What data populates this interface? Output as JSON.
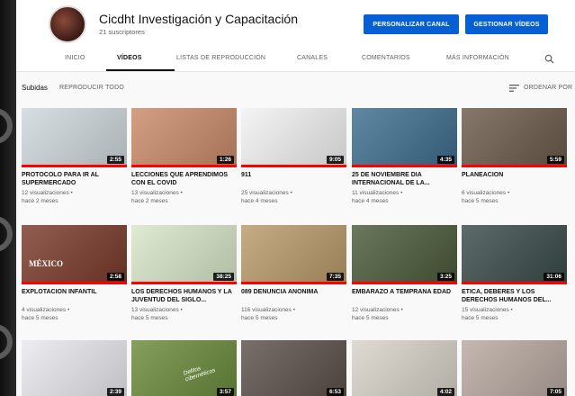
{
  "channel": {
    "name": "Cicdht Investigación y Capacitación",
    "subscribers": "21 suscriptores",
    "customize_label": "PERSONALIZAR CANAL",
    "manage_label": "GESTIONAR VÍDEOS"
  },
  "tabs": [
    {
      "label": "INICIO"
    },
    {
      "label": "VÍDEOS"
    },
    {
      "label": "LISTAS DE REPRODUCCIÓN"
    },
    {
      "label": "CANALES"
    },
    {
      "label": "COMENTARIOS"
    },
    {
      "label": "MÁS INFORMACIÓN"
    }
  ],
  "uploads": {
    "title": "Subidas",
    "play_all": "REPRODUCIR TODO",
    "sort_label": "ORDENAR POR"
  },
  "videos": [
    {
      "title": "PROTOCOLO PARA IR AL SUPERMERCADO",
      "views": "12 visualizaciones •",
      "age": "hace 2 meses",
      "duration": "2:55",
      "progress": 1.0
    },
    {
      "title": "LECCIONES QUE APRENDIMOS CON EL COVID",
      "views": "13 visualizaciones •",
      "age": "hace 2 meses",
      "duration": "1:26",
      "progress": 1.0
    },
    {
      "title": "911",
      "views": "25 visualizaciones •",
      "age": "hace 4 meses",
      "duration": "9:05",
      "progress": 1.0
    },
    {
      "title": "25 DE NOVIEMBRE DÍA INTERNACIONAL DE LA...",
      "views": "11 visualizaciones •",
      "age": "hace 4 meses",
      "duration": "4:35",
      "progress": 1.0
    },
    {
      "title": "PLANEACION",
      "views": "6 visualizaciones •",
      "age": "hace 5 meses",
      "duration": "5:59",
      "progress": 1.0
    },
    {
      "title": "EXPLOTACIÓN INFANTIL",
      "views": "4 visualizaciones •",
      "age": "hace 5 meses",
      "duration": "2:58",
      "progress": 1.0
    },
    {
      "title": "LOS DERECHOS HUMANOS Y LA JUVENTUD DEL SIGLO...",
      "views": "13 visualizaciones •",
      "age": "hace 5 meses",
      "duration": "38:25",
      "progress": 1.0
    },
    {
      "title": "089 DENUNCIA ANÓNIMA",
      "views": "116 visualizaciones •",
      "age": "hace 5 meses",
      "duration": "7:35",
      "progress": 1.0
    },
    {
      "title": "EMBARAZO A TEMPRANA EDAD",
      "views": "12 visualizaciones •",
      "age": "hace 5 meses",
      "duration": "3:25",
      "progress": 1.0
    },
    {
      "title": "ÉTICA, DEBERES Y LOS DERECHOS HUMANOS DEL...",
      "views": "15 visualizaciones •",
      "age": "hace 5 meses",
      "duration": "31:06",
      "progress": 1.0
    },
    {
      "title": "",
      "views": "",
      "age": "",
      "duration": "2:39",
      "progress": 0
    },
    {
      "title": "",
      "views": "",
      "age": "",
      "duration": "3:57",
      "progress": 0
    },
    {
      "title": "",
      "views": "",
      "age": "",
      "duration": "6:53",
      "progress": 0
    },
    {
      "title": "",
      "views": "",
      "age": "",
      "duration": "4:02",
      "progress": 0
    },
    {
      "title": "",
      "views": "",
      "age": "",
      "duration": "7:05",
      "progress": 0
    }
  ],
  "thumb_colors": [
    "#cfd8dc",
    "#c98a6a",
    "#f2f2f2",
    "#3e6e8e",
    "#6b5a4a",
    "#7a3a2a",
    "#d7e6c8",
    "#b89a6a",
    "#4a5a3a",
    "#3a4a4a",
    "#e9e9ee",
    "#6a8a3a",
    "#5a5048",
    "#d8d2c8",
    "#b8a8a0"
  ],
  "thumb_text": {
    "v6_text": "MÉXICO",
    "v11_text": "Delitos cibernéticos"
  },
  "colors": {
    "accent": "#065fd4",
    "progress": "#ff0000"
  }
}
